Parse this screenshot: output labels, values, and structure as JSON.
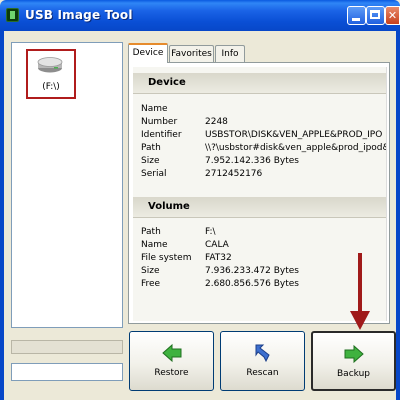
{
  "window": {
    "title": "USB Image Tool"
  },
  "drives": [
    {
      "label": "(F:\\)"
    }
  ],
  "tabs": [
    {
      "label": "Device",
      "active": true
    },
    {
      "label": "Favorites",
      "active": false
    },
    {
      "label": "Info",
      "active": false
    }
  ],
  "device": {
    "header": "Device",
    "rows": [
      {
        "key": "Name",
        "value": ""
      },
      {
        "key": "Number",
        "value": "2248"
      },
      {
        "key": "Identifier",
        "value": "USBSTOR\\DISK&VEN_APPLE&PROD_IPO"
      },
      {
        "key": "Path",
        "value": "\\\\?\\usbstor#disk&ven_apple&prod_ipod&rev"
      },
      {
        "key": "Size",
        "value": "7.952.142.336 Bytes"
      },
      {
        "key": "Serial",
        "value": "2712452176"
      }
    ]
  },
  "volume": {
    "header": "Volume",
    "rows": [
      {
        "key": "Path",
        "value": "F:\\"
      },
      {
        "key": "Name",
        "value": "CALA"
      },
      {
        "key": "File system",
        "value": "FAT32"
      },
      {
        "key": "Size",
        "value": "7.936.233.472 Bytes"
      },
      {
        "key": "Free",
        "value": "2.680.856.576 Bytes"
      }
    ]
  },
  "buttons": {
    "restore": "Restore",
    "rescan": "Rescan",
    "backup": "Backup"
  },
  "icons": {
    "app": "usb-app-icon",
    "drive": "usb-drive-icon",
    "restore": "green-left-arrow-icon",
    "rescan": "blue-refresh-icon",
    "backup": "green-right-arrow-icon"
  },
  "colors": {
    "titlebar": "#0a4fd5",
    "highlight_box": "#b01c1c",
    "arrow": "#a01a1a",
    "green_icon": "#3fb23f",
    "blue_icon": "#3d6fcf"
  }
}
